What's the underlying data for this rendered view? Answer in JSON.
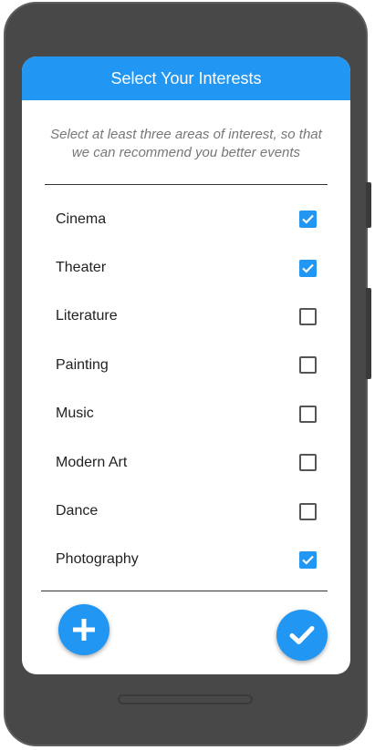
{
  "header": {
    "title": "Select Your Interests"
  },
  "subtitle": "Select at least three areas of interest, so that we can recommend you better events",
  "interests": [
    {
      "label": "Cinema",
      "checked": true
    },
    {
      "label": "Theater",
      "checked": true
    },
    {
      "label": "Literature",
      "checked": false
    },
    {
      "label": "Painting",
      "checked": false
    },
    {
      "label": "Music",
      "checked": false
    },
    {
      "label": "Modern Art",
      "checked": false
    },
    {
      "label": "Dance",
      "checked": false
    },
    {
      "label": "Photography",
      "checked": true
    }
  ],
  "actions": {
    "add_icon": "plus-icon",
    "done_icon": "checkmark-icon"
  },
  "colors": {
    "accent": "#2196f3",
    "frame": "#484848"
  }
}
